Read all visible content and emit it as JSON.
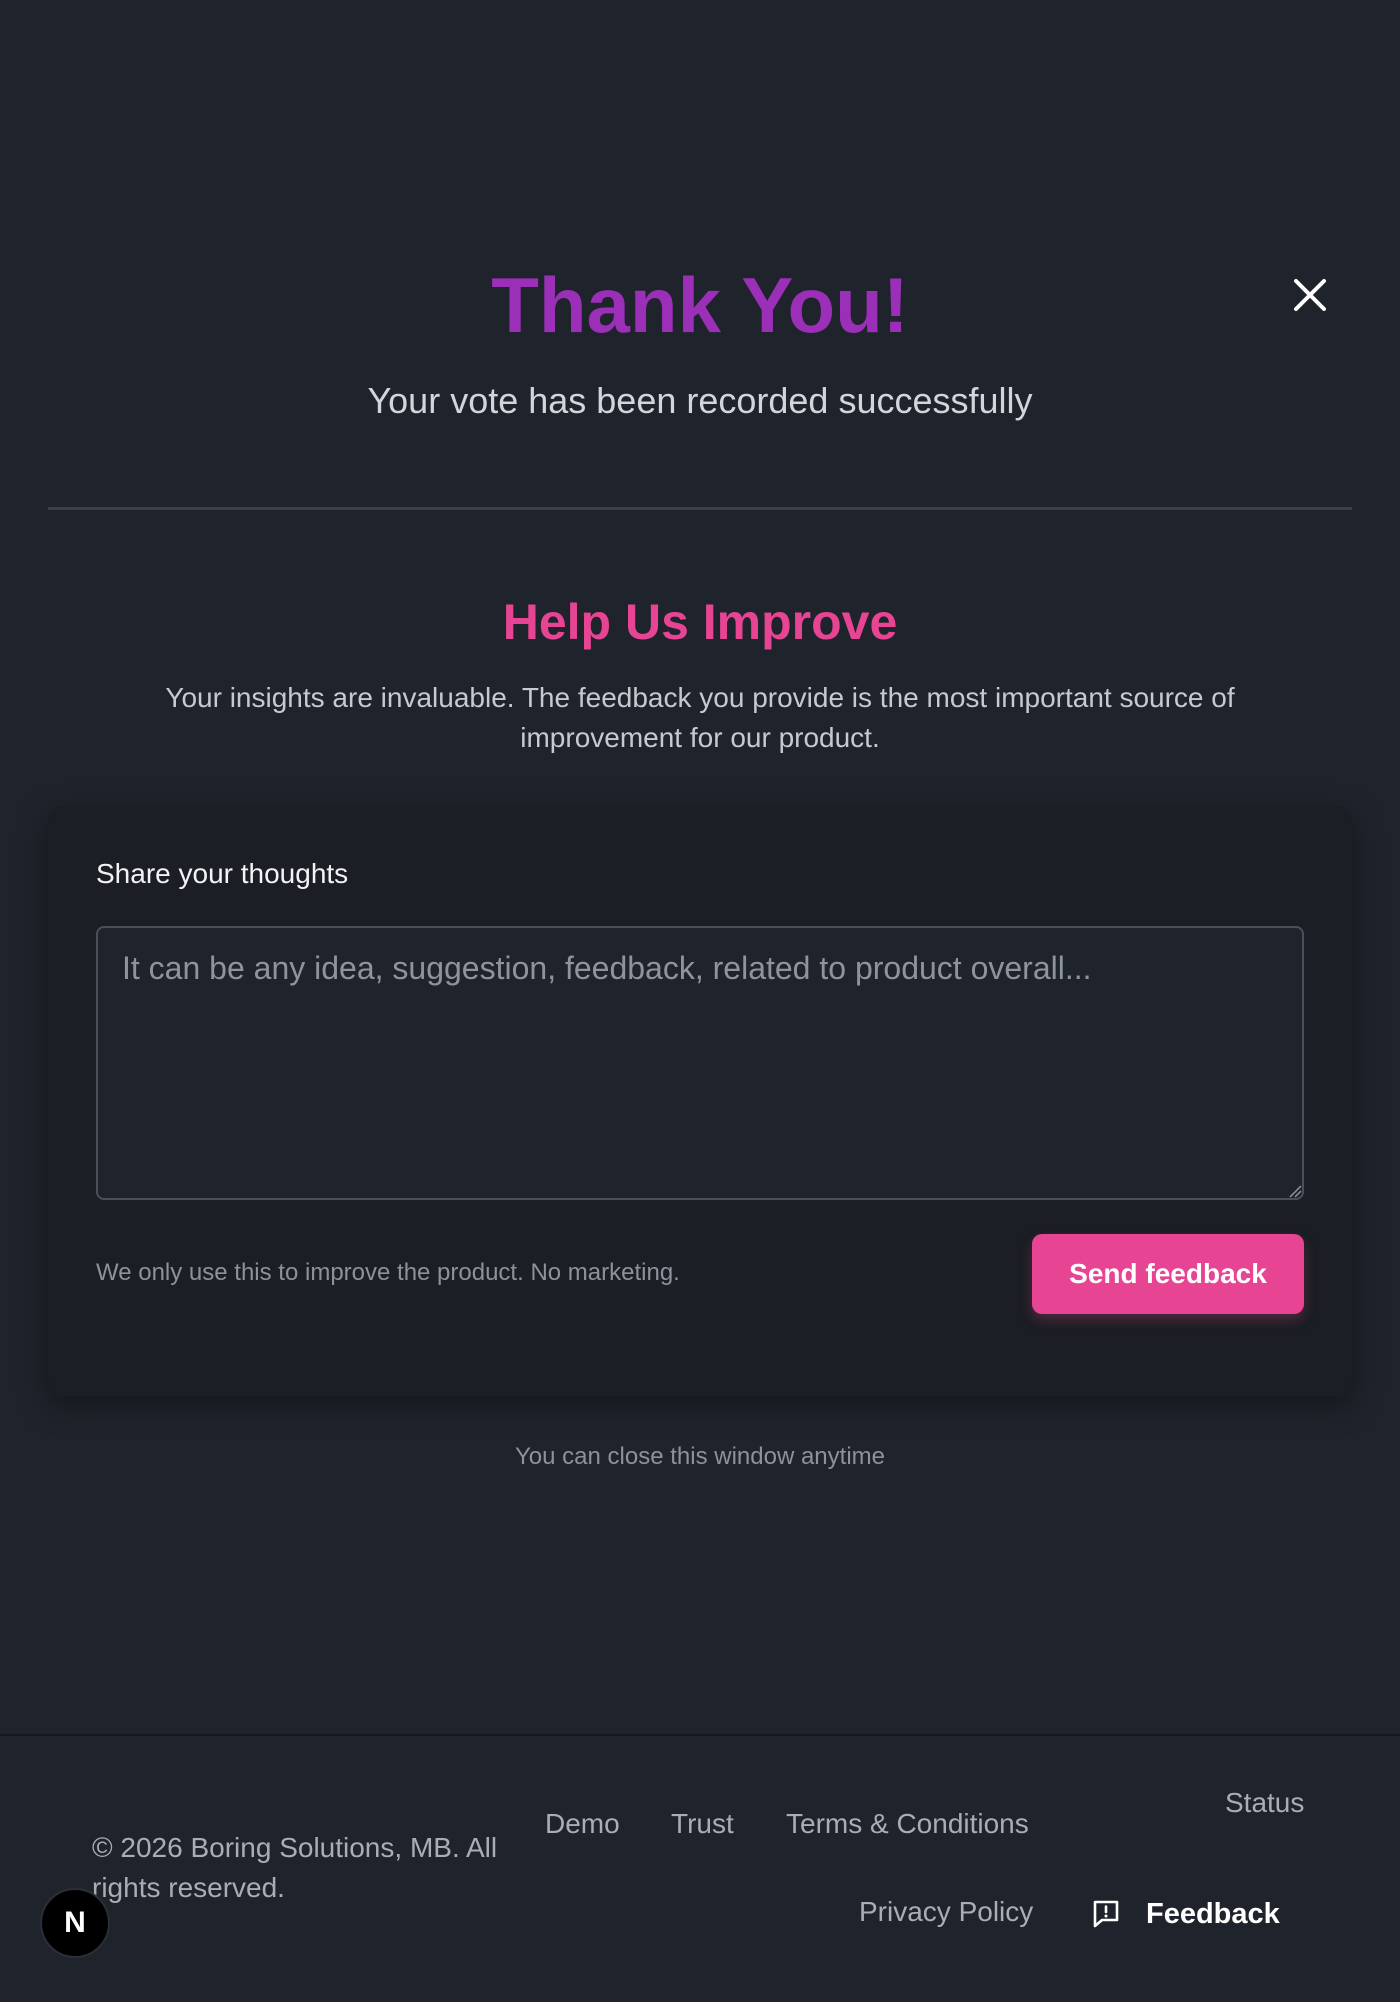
{
  "modal": {
    "title": "Thank You!",
    "subtitle": "Your vote has been recorded successfully",
    "close_icon": "close-icon"
  },
  "improve": {
    "title": "Help Us Improve",
    "description": "Your insights are invaluable. The feedback you provide is the most important source of improvement for our product."
  },
  "feedback_form": {
    "label": "Share your thoughts",
    "placeholder": "It can be any idea, suggestion, feedback, related to product overall...",
    "value": "",
    "privacy_note": "We only use this to improve the product. No marketing.",
    "send_label": "Send feedback"
  },
  "close_hint": "You can close this window anytime",
  "footer": {
    "copyright": "© 2026 Boring Solutions, MB. All rights reserved.",
    "links": {
      "demo": "Demo",
      "trust": "Trust",
      "terms": "Terms & Conditions",
      "status": "Status",
      "privacy": "Privacy Policy"
    },
    "feedback_label": "Feedback",
    "feedback_icon": "message-alert-icon"
  },
  "badge": {
    "letter": "N"
  },
  "colors": {
    "background": "#1f232b",
    "title_purple": "#9b2fb8",
    "accent_pink": "#e74594",
    "card_bg": "#1b1e24"
  }
}
